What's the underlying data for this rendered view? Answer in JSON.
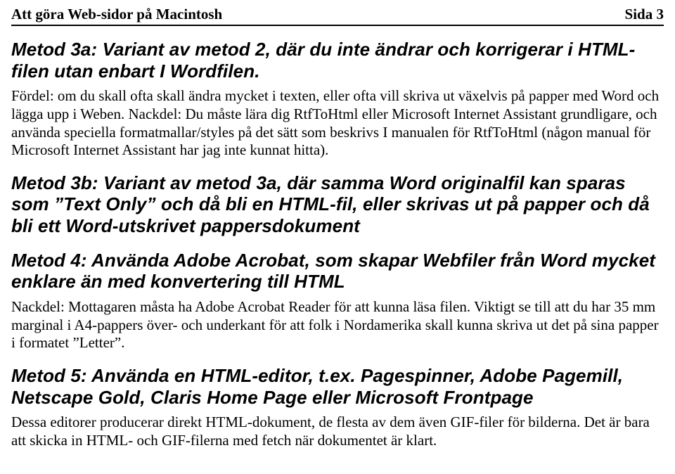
{
  "header": {
    "left": "Att göra Web-sidor på Macintosh",
    "right": "Sida 3"
  },
  "sections": {
    "h3a": "Metod 3a: Variant av metod 2, där du inte ändrar och korrigerar i HTML-filen utan enbart I Wordfilen.",
    "p3a": "Fördel: om du skall ofta skall ändra mycket i texten, eller ofta vill skriva ut växelvis på papper med Word och lägga upp i Weben. Nackdel: Du måste lära dig RtfToHtml eller Microsoft Internet Assistant grundligare, och använda speciella formatmallar/styles på det sätt som beskrivs I manualen för RtfToHtml (någon manual för Microsoft Internet Assistant har jag inte kunnat hitta).",
    "h3b": "Metod 3b: Variant av metod 3a, där samma Word originalfil kan sparas som ”Text Only” och då bli en HTML-fil, eller skrivas ut på papper och då bli ett Word-utskrivet pappersdokument",
    "h4": "Metod 4: Använda Adobe Acrobat, som skapar Webfiler från Word mycket enklare än med konvertering till HTML",
    "p4": "Nackdel: Mottagaren måsta ha Adobe Acrobat Reader för att kunna läsa filen. Viktigt se till att du har 35 mm marginal i A4-pappers över- och underkant för att folk i Nordamerika skall kunna skriva ut det på sina papper i formatet ”Letter”.",
    "h5": "Metod 5: Använda en HTML-editor, t.ex. Pagespinner, Adobe Pagemill, Netscape Gold, Claris Home Page eller Microsoft Frontpage",
    "p5": "Dessa editorer producerar direkt HTML-dokument, de flesta av dem även GIF-filer för bilderna. Det är bara att skicka in HTML- och GIF-filerna med fetch när dokumentet är klart."
  }
}
